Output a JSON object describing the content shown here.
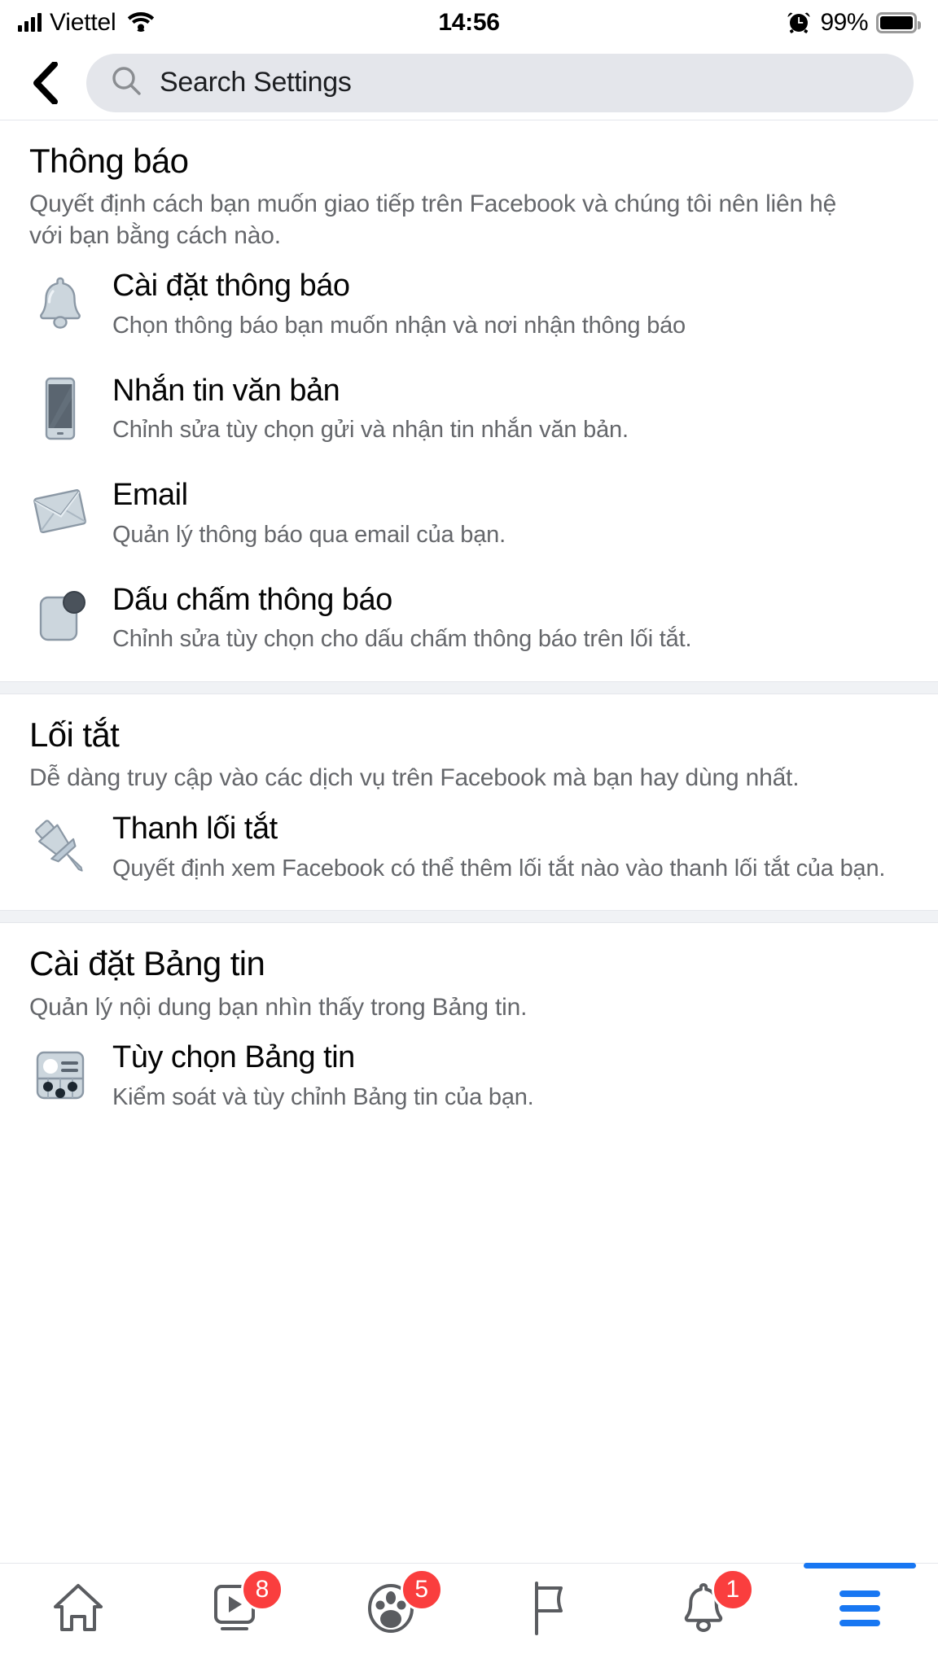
{
  "status_bar": {
    "carrier": "Viettel",
    "time": "14:56",
    "battery_percent": "99%",
    "wifi_icon": "wifi-icon",
    "signal_icon": "signal-bars-icon",
    "alarm_icon": "alarm-clock-icon",
    "battery_icon": "battery-full-icon"
  },
  "header": {
    "back_icon": "back-chevron-icon",
    "search_icon": "search-icon",
    "search_placeholder": "Search Settings",
    "search_value": "Search Settings"
  },
  "sections": [
    {
      "title": "Thông báo",
      "description": "Quyết định cách bạn muốn giao tiếp trên Facebook và chúng tôi nên liên hệ với bạn bằng cách nào.",
      "items": [
        {
          "icon": "bell-icon",
          "title": "Cài đặt thông báo",
          "subtitle": "Chọn thông báo bạn muốn nhận và nơi nhận thông báo"
        },
        {
          "icon": "mobile-phone-icon",
          "title": "Nhắn tin văn bản",
          "subtitle": "Chỉnh sửa tùy chọn gửi và nhận tin nhắn văn bản."
        },
        {
          "icon": "envelope-icon",
          "title": "Email",
          "subtitle": "Quản lý thông báo qua email của bạn."
        },
        {
          "icon": "notification-dot-icon",
          "title": "Dấu chấm thông báo",
          "subtitle": "Chỉnh sửa tùy chọn cho dấu chấm thông báo trên lối tắt."
        }
      ]
    },
    {
      "title": "Lối tắt",
      "description": "Dễ dàng truy cập vào các dịch vụ trên Facebook mà bạn hay dùng nhất.",
      "items": [
        {
          "icon": "pushpin-icon",
          "title": "Thanh lối tắt",
          "subtitle": "Quyết định xem Facebook có thể thêm lối tắt nào vào thanh lối tắt của bạn."
        }
      ]
    },
    {
      "title": "Cài đặt Bảng tin",
      "description": "Quản lý nội dung bạn nhìn thấy trong Bảng tin.",
      "items": [
        {
          "icon": "news-feed-icon",
          "title": "Tùy chọn Bảng tin",
          "subtitle": "Kiểm soát và tùy chỉnh Bảng tin của bạn."
        }
      ]
    }
  ],
  "bottom_nav": {
    "active_color": "#1877f2",
    "badge_color": "#fa3e3e",
    "items": [
      {
        "icon": "home-icon",
        "badge": "",
        "active": false
      },
      {
        "icon": "watch-video-icon",
        "badge": "8",
        "active": false
      },
      {
        "icon": "groups-icon",
        "badge": "5",
        "active": false
      },
      {
        "icon": "marketplace-flag-icon",
        "badge": "",
        "active": false
      },
      {
        "icon": "notifications-bell-icon",
        "badge": "1",
        "active": false
      },
      {
        "icon": "hamburger-menu-icon",
        "badge": "",
        "active": true
      }
    ]
  }
}
